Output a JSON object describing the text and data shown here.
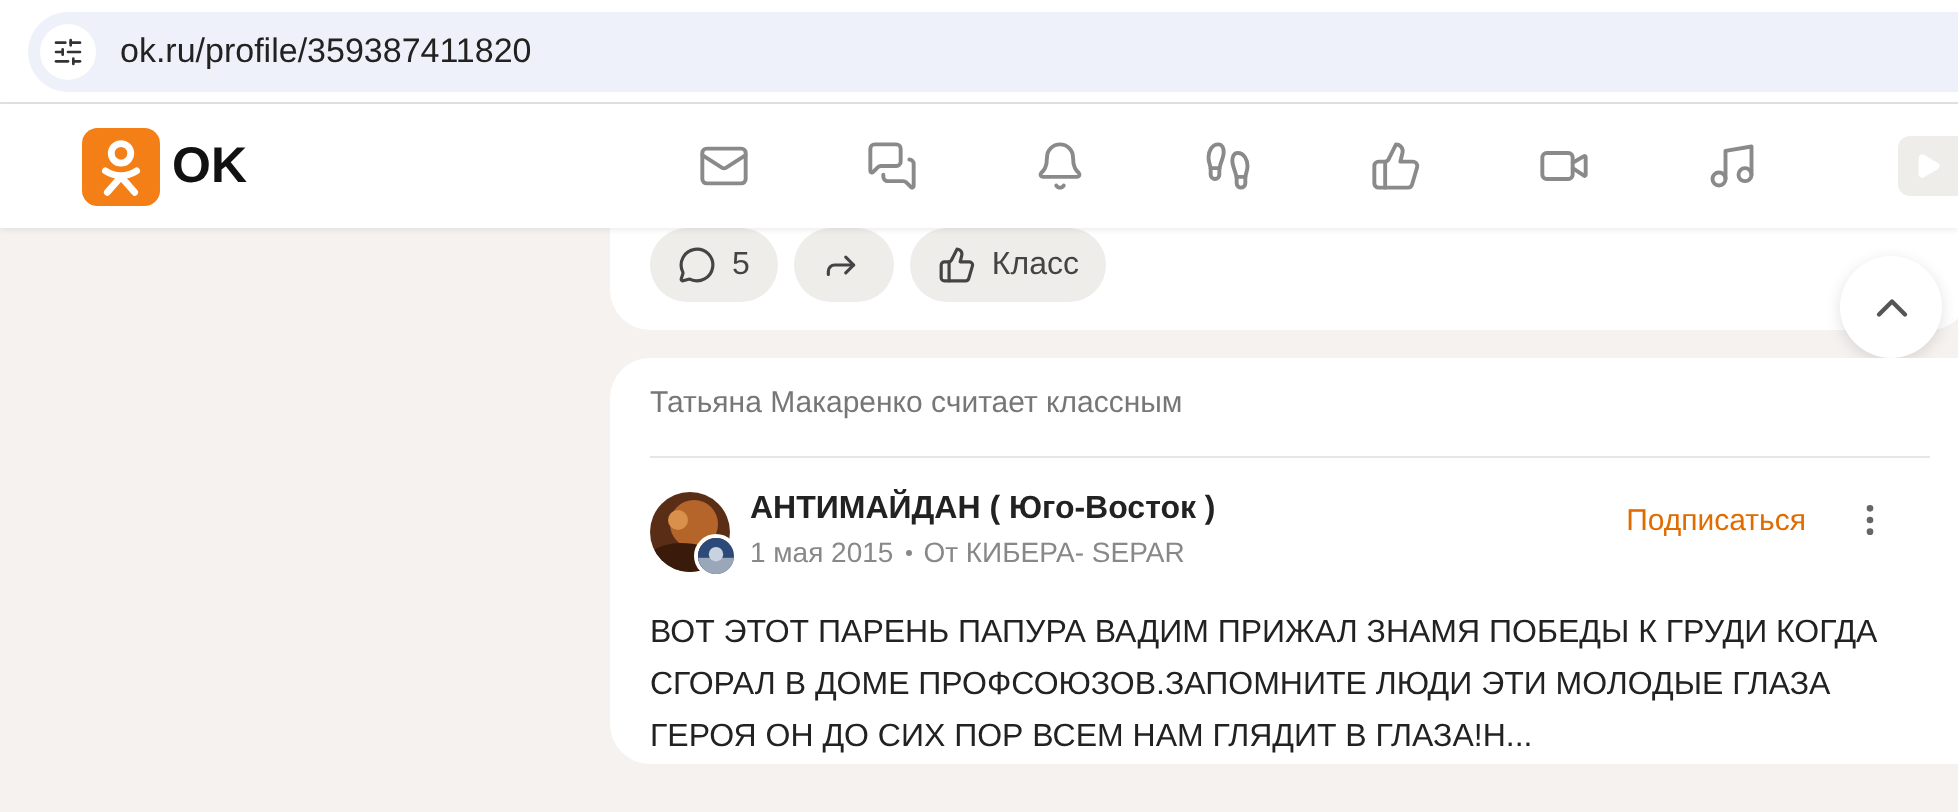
{
  "address_bar": {
    "url": "ok.ru/profile/359387411820"
  },
  "header": {
    "logo_text": "OK",
    "nav": [
      {
        "kind": "mail"
      },
      {
        "kind": "chat"
      },
      {
        "kind": "bell"
      },
      {
        "kind": "steps"
      },
      {
        "kind": "like"
      },
      {
        "kind": "video"
      },
      {
        "kind": "music"
      }
    ]
  },
  "previous_post": {
    "actions": [
      {
        "kind": "comment",
        "label": "5"
      },
      {
        "kind": "share"
      },
      {
        "kind": "like",
        "label": "Класс"
      }
    ]
  },
  "feed_item": {
    "context": "Татьяна Макаренко считает классным",
    "author": "АНТИМАЙДАН ( Юго-Восток )",
    "date": "1 мая 2015",
    "source": "От КИБЕРА- SEPAR",
    "subscribe": "Подписаться",
    "text": "ВОТ ЭТОТ ПАРЕНЬ ПАПУРА ВАДИМ ПРИЖАЛ ЗНАМЯ ПОБЕДЫ К ГРУДИ КОГДА СГОРАЛ В ДОМЕ ПРОФСОЮЗОВ.ЗАПОМНИТЕ ЛЮДИ ЭТИ МОЛОДЫЕ ГЛАЗА ГЕРОЯ ОН ДО СИХ ПОР ВСЕМ НАМ ГЛЯДИТ В ГЛАЗА!Н..."
  }
}
